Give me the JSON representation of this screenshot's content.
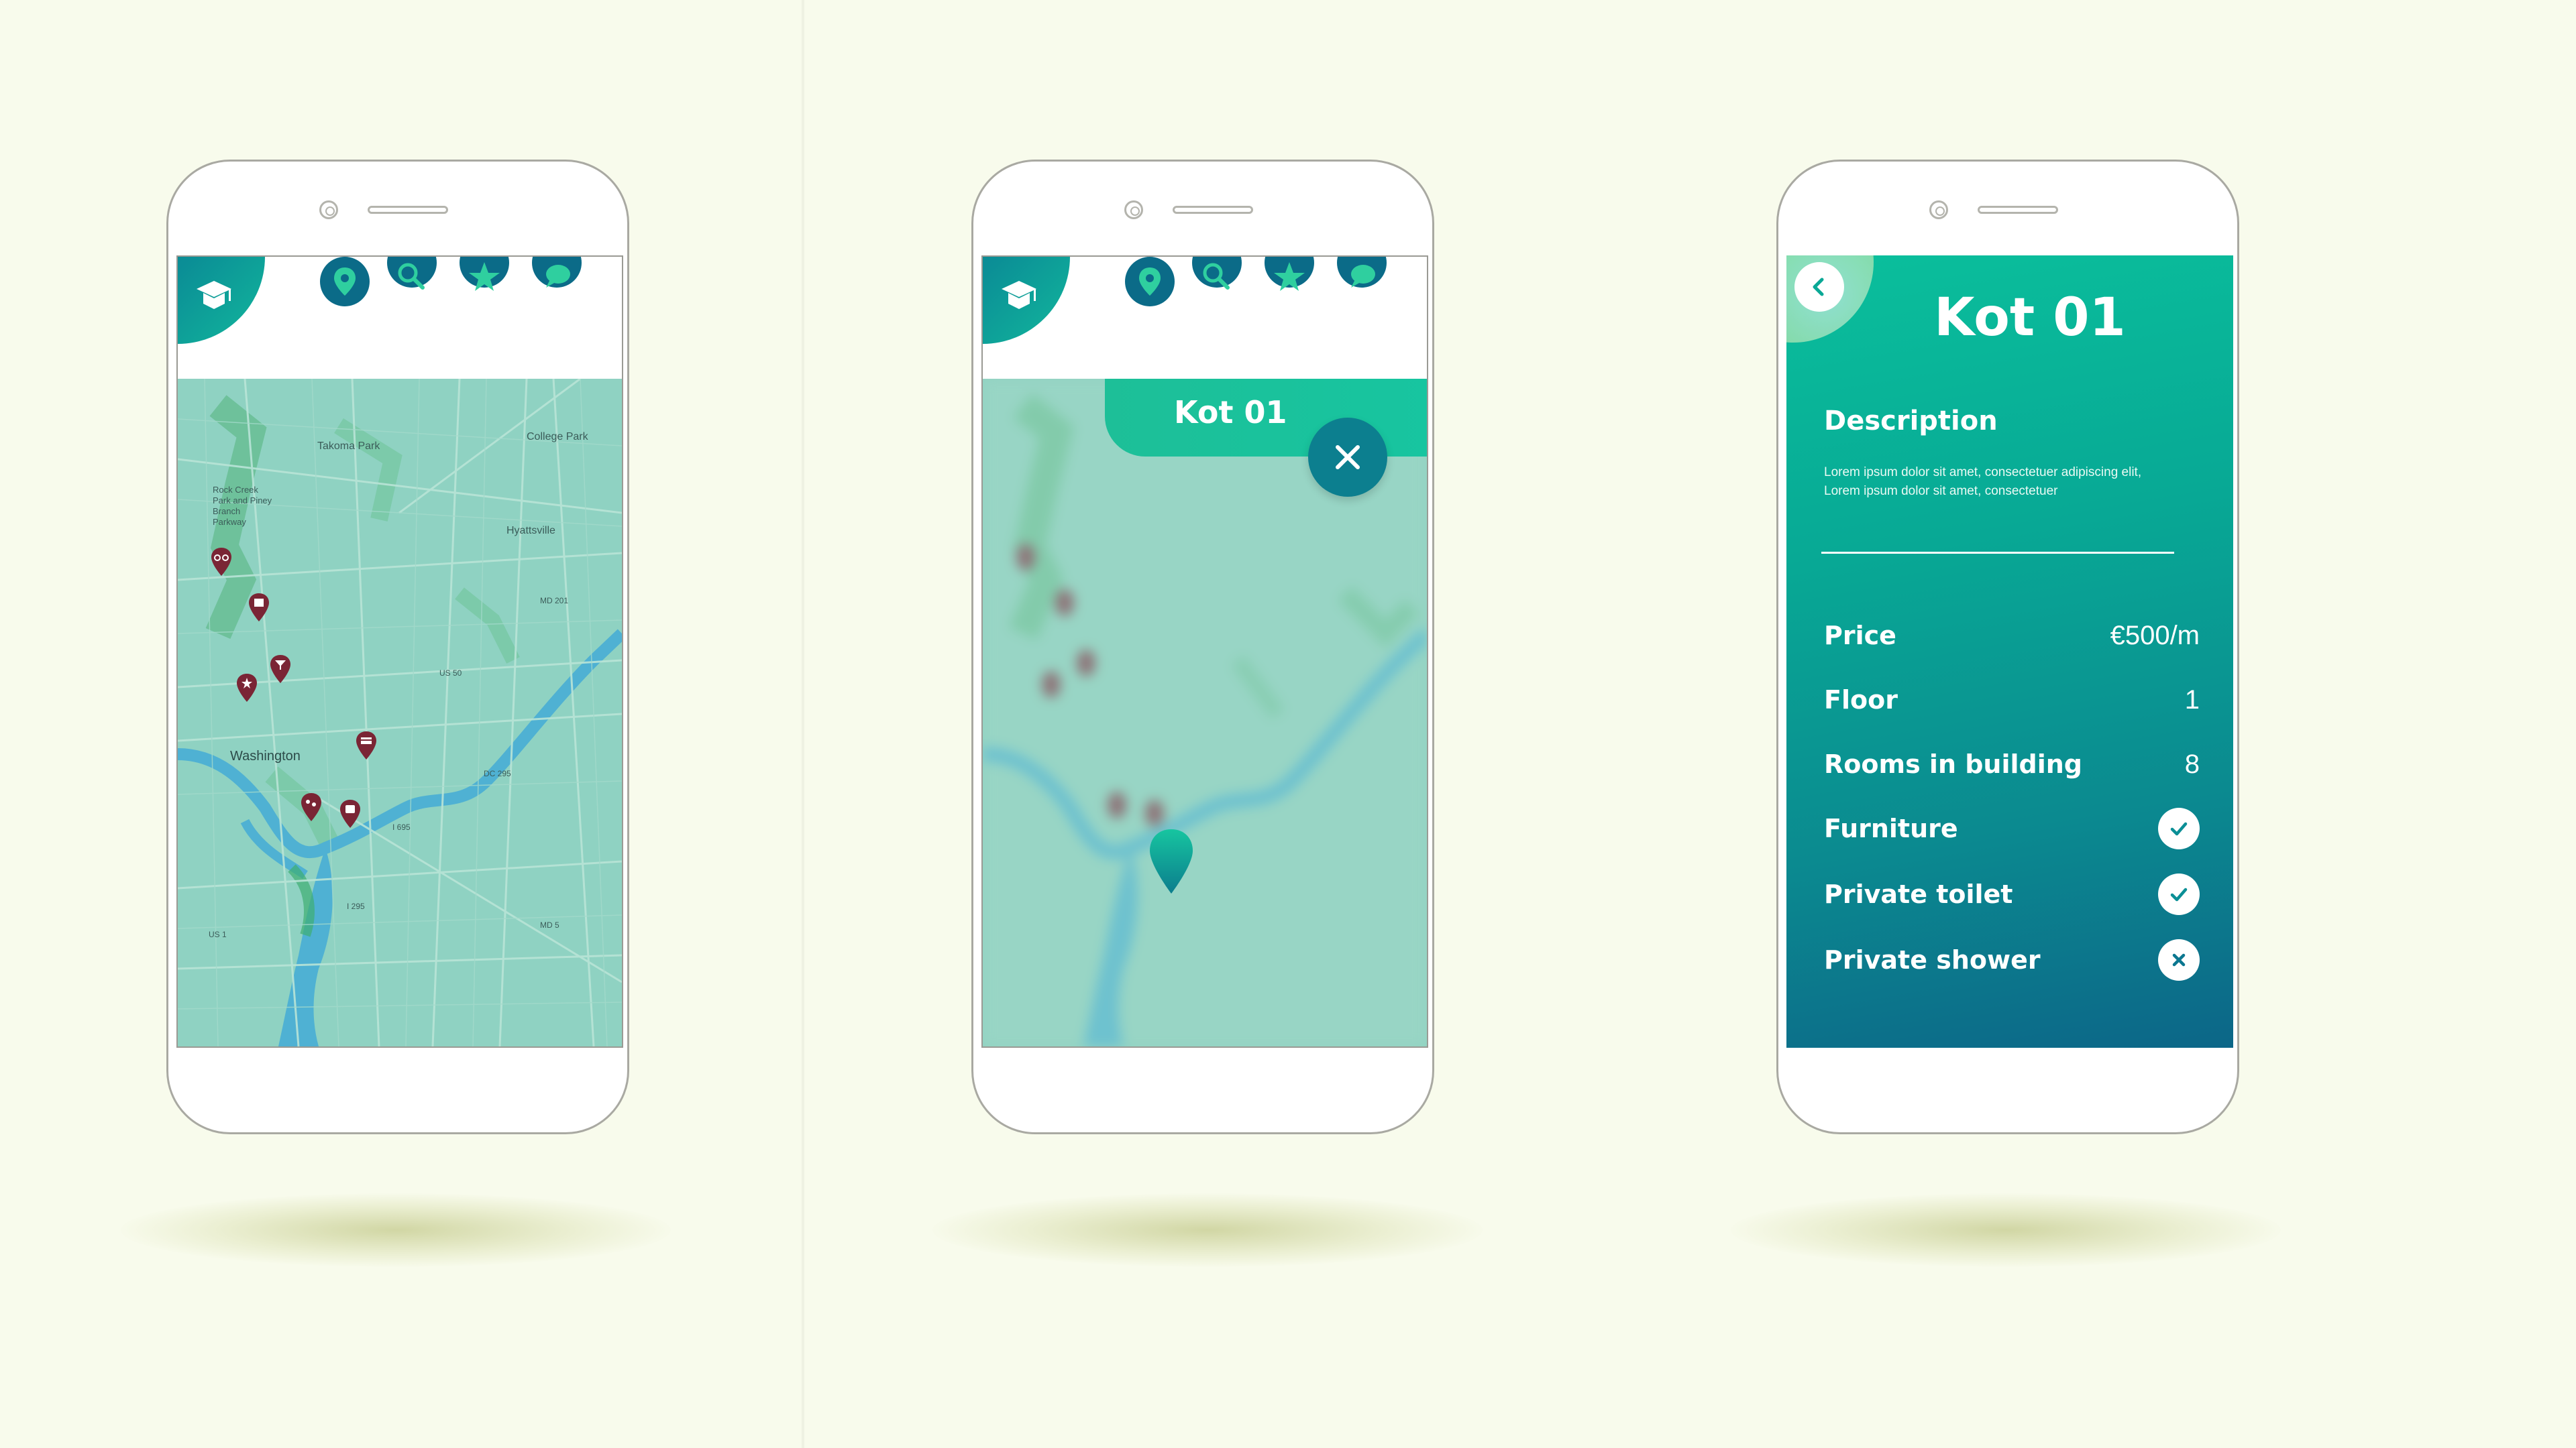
{
  "colors": {
    "background": "#f8fbec",
    "primary": "#0b6b88",
    "accent": "#17c5a0",
    "pin": "#7a2535",
    "map_water": "#54b9d6",
    "map_land": "#8fd2c2"
  },
  "nav": {
    "icons": [
      "map-pin-icon",
      "search-icon",
      "star-icon",
      "chat-icon"
    ]
  },
  "screen1": {
    "map_labels": {
      "takoma": "Takoma Park",
      "college": "College Park",
      "rock_creek": "Rock Creek Park and Piney Branch Parkway",
      "hyattsville": "Hyattsville",
      "washington": "Washington",
      "us1": "US 1",
      "md201": "MD 201",
      "us50": "US 50",
      "dc295": "DC 295",
      "i695": "I 695",
      "i295": "I 295",
      "md5": "MD 5"
    },
    "pins": [
      "bike-icon",
      "building-icon",
      "cocktail-icon",
      "star-icon",
      "shop-icon",
      "gamepad-icon",
      "bus-icon"
    ]
  },
  "screen2": {
    "popup_title": "Kot 01"
  },
  "screen3": {
    "title": "Kot 01",
    "description_heading": "Description",
    "description_text": "Lorem ipsum dolor sit amet, consectetuer adipiscing elit,  Lorem ipsum dolor sit amet, consectetuer",
    "rows": [
      {
        "label": "Price",
        "value": "€500/m"
      },
      {
        "label": "Floor",
        "value": "1"
      },
      {
        "label": "Rooms in building",
        "value": "8"
      }
    ],
    "features": [
      {
        "label": "Furniture",
        "available": true
      },
      {
        "label": "Private toilet",
        "available": true
      },
      {
        "label": "Private shower",
        "available": false
      }
    ]
  }
}
